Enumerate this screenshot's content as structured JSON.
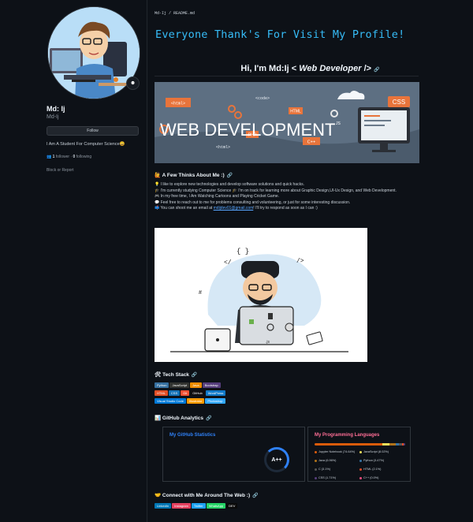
{
  "sidebar": {
    "name": "Md: Ij",
    "login": "Md-Ij",
    "follow_label": "Follow",
    "bio": "I Am A Student For Computer Science😀",
    "followers_count": "1",
    "followers_label": "follower",
    "separator": " · ",
    "following_count": "0",
    "following_label": "following",
    "block_label": "Block or Report"
  },
  "readme": {
    "breadcrumb": "Md-Ij / README.md",
    "typing_title": "Everyone Thank's For Visit My Profile!",
    "hi_prefix": "Hi, I'm Md:Ij < ",
    "hi_role": "Web Developer",
    "hi_suffix": " />",
    "banner_text": "WEB DEVELOPMENT",
    "banner_tags": [
      "<html>",
      "<code>",
      "HTML",
      "CSS",
      "C++",
      "PHP",
      "JS"
    ],
    "thoughts_heading": "A Few Thinks About Me :)",
    "thoughts_icon": "🙋",
    "thoughts": [
      {
        "icon": "💡",
        "text": "I like to explore new technologies and develop software solutions and quick hacks."
      },
      {
        "icon": "🎓",
        "text": "I'm currently studying Computer Science 🎓 I'm on track for learning more about Graphic Design,UI-Ux Design, and Web Development."
      },
      {
        "icon": "🎮",
        "text": "In my free time, I Am Watching Cartoons and Playing Cricket Game."
      },
      {
        "icon": "💬",
        "text": "Feel free to reach out to me for problems consulting and volunteering, or just for some interesting discussion."
      }
    ],
    "email_prefix": "You can shoot me an email at ",
    "email": "mdijdev01@gmail.com",
    "email_suffix": "! I'll try to respond as soon as I can :)",
    "email_icon": "📫",
    "tech_heading": "Tech Stack",
    "tech_icon": "🛠",
    "tech_rows": [
      [
        {
          "label": "Python",
          "color": "#3670a0"
        },
        {
          "label": "JavaScript",
          "color": "#323330"
        },
        {
          "label": "Java",
          "color": "#ed8b00"
        },
        {
          "label": "Bootstrap",
          "color": "#563d7c"
        }
      ],
      [
        {
          "label": "HTML",
          "color": "#e34f26"
        },
        {
          "label": "CSS",
          "color": "#1572b6"
        },
        {
          "label": "Git",
          "color": "#f05033"
        },
        {
          "label": "GitHub",
          "color": "#121011"
        },
        {
          "label": "WordPress",
          "color": "#117ac9"
        }
      ],
      [
        {
          "label": "Visual Studio Code",
          "color": "#0078d7"
        },
        {
          "label": "Illustrator",
          "color": "#ff9a00"
        },
        {
          "label": "Photoshop",
          "color": "#31a8ff"
        }
      ]
    ],
    "analytics_heading": "GitHub Analytics",
    "analytics_icon": "📊",
    "stats_card": {
      "title": "My GitHub Statistics",
      "grade": "A++",
      "title_color": "#2f81f7"
    },
    "langs_card": {
      "title": "My Programming Languages",
      "title_color": "#ff6e96",
      "languages": [
        {
          "name": "Jupyter Notebook",
          "pct": 74.64,
          "label": "Jupyter Notebook (74.64%)",
          "color": "#da5b0b"
        },
        {
          "name": "JavaScript",
          "pct": 8.02,
          "label": "JavaScript (8.02%)",
          "color": "#f1e05a"
        },
        {
          "name": "Java",
          "pct": 6.96,
          "label": "Java (6.96%)",
          "color": "#b07219"
        },
        {
          "name": "Python",
          "pct": 3.47,
          "label": "Python (3.47%)",
          "color": "#3572a5"
        },
        {
          "name": "C",
          "pct": 3.1,
          "label": "C (3.1%)",
          "color": "#555555"
        },
        {
          "name": "HTML",
          "pct": 2.1,
          "label": "HTML (2.1%)",
          "color": "#e34c26"
        },
        {
          "name": "CSS",
          "pct": 1.71,
          "label": "CSS (1.71%)",
          "color": "#563d7c"
        },
        {
          "name": "C++",
          "pct": 0.0,
          "label": "C++ (0.0%)",
          "color": "#f34b7d"
        }
      ]
    },
    "connect_heading": "Connect with Me Around The Web :)",
    "connect_icon": "🤝",
    "connect_badges": [
      {
        "label": "LinkedIn",
        "color": "#0077b5"
      },
      {
        "label": "Instagram",
        "color": "#e4405f"
      },
      {
        "label": "Twitter",
        "color": "#1da1f2"
      },
      {
        "label": "WhatsApp",
        "color": "#25d366"
      },
      {
        "label": "DEV",
        "color": "#0a0a0a"
      }
    ]
  }
}
